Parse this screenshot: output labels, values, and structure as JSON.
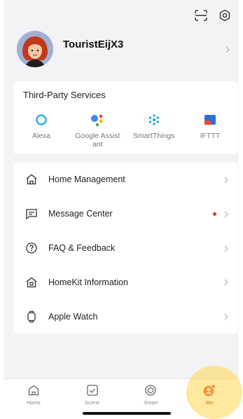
{
  "header": {
    "scan_icon": "scan-icon",
    "settings_icon": "settings-icon"
  },
  "profile": {
    "username": "TouristEijX3"
  },
  "services": {
    "title": "Third-Party Services",
    "items": [
      {
        "label": "Alexa",
        "icon": "alexa-icon"
      },
      {
        "label": "Google Assistant",
        "icon": "google-assistant-icon"
      },
      {
        "label": "SmartThings",
        "icon": "smartthings-icon"
      },
      {
        "label": "IFTTT",
        "icon": "ifttt-icon"
      }
    ]
  },
  "menu": {
    "items": [
      {
        "label": "Home Management",
        "icon": "home-icon",
        "has_dot": false
      },
      {
        "label": "Message Center",
        "icon": "message-icon",
        "has_dot": true
      },
      {
        "label": "FAQ & Feedback",
        "icon": "help-icon",
        "has_dot": false
      },
      {
        "label": "HomeKit Information",
        "icon": "homekit-icon",
        "has_dot": false
      },
      {
        "label": "Apple Watch",
        "icon": "watch-icon",
        "has_dot": false
      }
    ]
  },
  "tabs": [
    {
      "label": "Home",
      "icon": "home-tab-icon",
      "active": false
    },
    {
      "label": "Scene",
      "icon": "scene-tab-icon",
      "active": false
    },
    {
      "label": "Smart",
      "icon": "smart-tab-icon",
      "active": false
    },
    {
      "label": "Me",
      "icon": "me-tab-icon",
      "active": true
    }
  ],
  "colors": {
    "accent": "#e8442c",
    "badge": "#e03131",
    "highlight": "#ffd750"
  }
}
